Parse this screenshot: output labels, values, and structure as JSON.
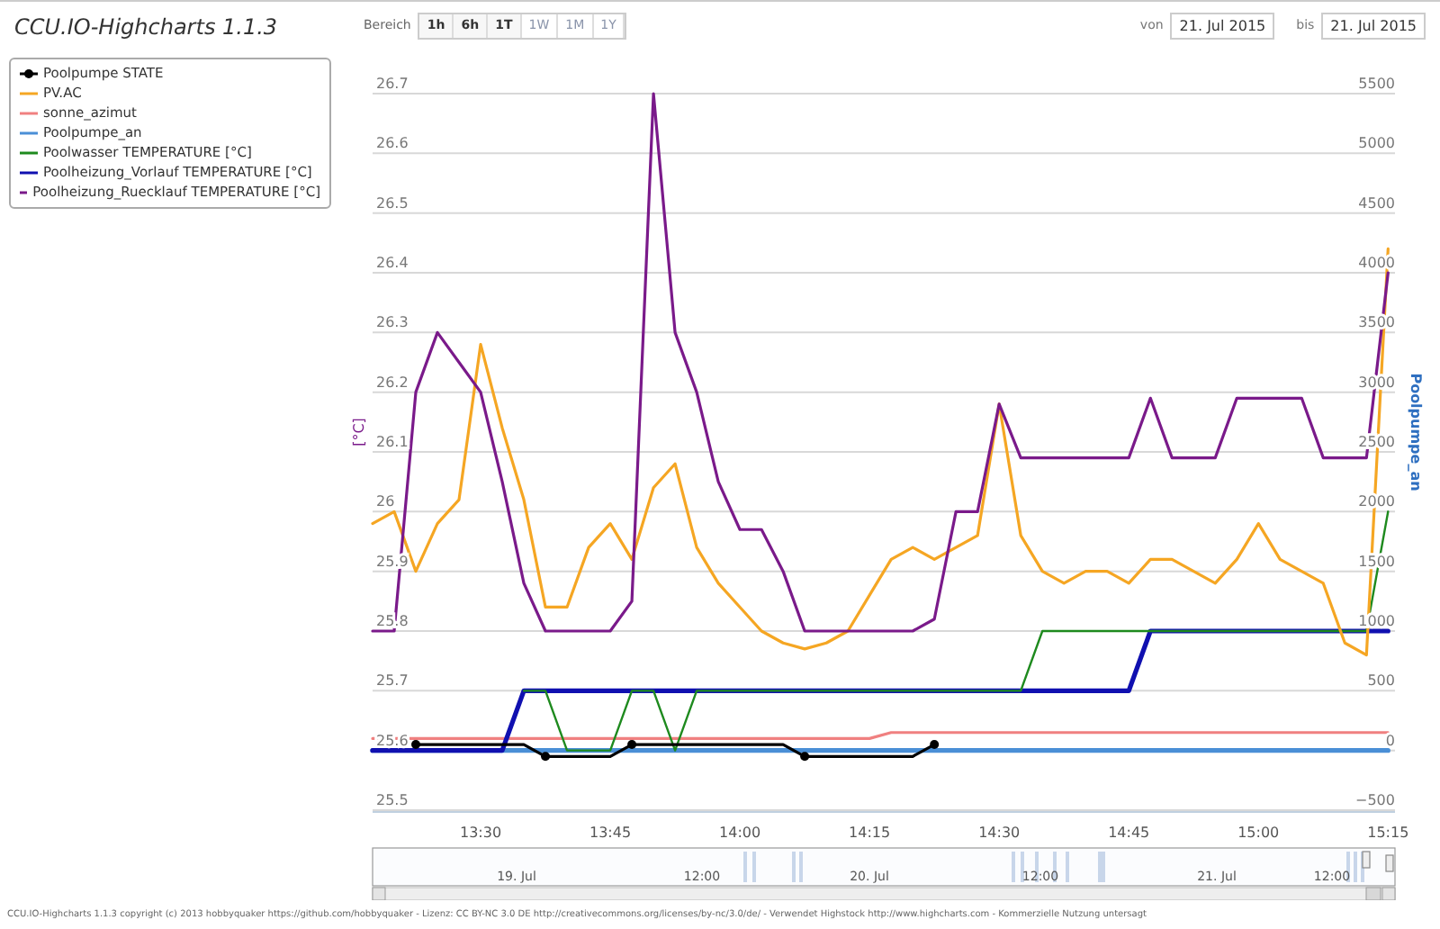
{
  "title": "CCU.IO-Highcharts 1.1.3",
  "range_selector": {
    "label": "Bereich",
    "buttons": [
      {
        "label": "1h",
        "disabled": false
      },
      {
        "label": "6h",
        "disabled": false
      },
      {
        "label": "1T",
        "disabled": false
      },
      {
        "label": "1W",
        "disabled": true
      },
      {
        "label": "1M",
        "disabled": true
      },
      {
        "label": "1Y",
        "disabled": true
      }
    ]
  },
  "date_range": {
    "from_label": "von",
    "from": "21. Jul 2015",
    "to_label": "bis",
    "to": "21. Jul 2015"
  },
  "chart": {
    "chart_data": {
      "type": "line",
      "grid": true,
      "ylabel": "[°C]",
      "ylim": [
        25.5,
        26.7
      ],
      "yticks": [
        25.5,
        25.6,
        25.7,
        25.8,
        25.9,
        {
          "value": 26,
          "label": "26"
        },
        26.1,
        26.2,
        26.3,
        26.4,
        26.5,
        26.6,
        26.7
      ],
      "xlim": [
        797.5,
        915.8
      ],
      "xticks": [
        {
          "value": 810,
          "label": "13:30"
        },
        {
          "value": 825,
          "label": "13:45"
        },
        {
          "value": 840,
          "label": "14:00"
        },
        {
          "value": 855,
          "label": "14:15"
        },
        {
          "value": 870,
          "label": "14:30"
        },
        {
          "value": 885,
          "label": "14:45"
        },
        {
          "value": 900,
          "label": "15:00"
        },
        {
          "value": 915,
          "label": "15:15"
        }
      ],
      "x": [
        797.5,
        800,
        802.5,
        805,
        807.5,
        810,
        812.5,
        815,
        817.5,
        820,
        822.5,
        825,
        827.5,
        830,
        832.5,
        835,
        837.5,
        840,
        842.5,
        845,
        847.5,
        850,
        852.5,
        855,
        857.5,
        860,
        862.5,
        865,
        867.5,
        870,
        872.5,
        875,
        877.5,
        880,
        882.5,
        885,
        887.5,
        890,
        892.5,
        895,
        897.5,
        900,
        902.5,
        905,
        907.5,
        910,
        912.5,
        915
      ],
      "series": [
        {
          "name": "Poolpumpe STATE",
          "color": "#000000",
          "values": [
            null,
            null,
            25.61,
            25.61,
            25.61,
            25.61,
            25.61,
            25.61,
            25.59,
            25.59,
            25.59,
            25.59,
            25.61,
            25.61,
            25.61,
            25.61,
            25.61,
            25.61,
            25.61,
            25.61,
            25.59,
            25.59,
            25.59,
            25.59,
            25.59,
            25.59,
            25.61,
            null,
            null,
            null,
            null,
            null,
            null,
            null,
            null,
            null,
            null,
            null,
            null,
            null,
            null,
            null,
            null,
            null,
            null,
            null,
            null,
            null
          ]
        },
        {
          "name": "PV.AC",
          "color": "#f5a623",
          "values": [
            25.98,
            26.0,
            25.9,
            25.98,
            26.02,
            26.28,
            26.14,
            26.02,
            25.84,
            25.84,
            25.94,
            25.98,
            25.92,
            26.04,
            26.08,
            25.94,
            25.88,
            25.84,
            25.8,
            25.78,
            25.77,
            25.78,
            25.8,
            25.86,
            25.92,
            25.94,
            25.92,
            25.94,
            25.96,
            26.18,
            25.96,
            25.9,
            25.88,
            25.9,
            25.9,
            25.88,
            25.92,
            25.92,
            25.9,
            25.88,
            25.92,
            25.98,
            25.92,
            25.9,
            25.88,
            25.78,
            25.76,
            26.44
          ]
        },
        {
          "name": "sonne_azimut",
          "color": "#f08080",
          "values": [
            25.62,
            25.62,
            25.62,
            25.62,
            25.62,
            25.62,
            25.62,
            25.62,
            25.62,
            25.62,
            25.62,
            25.62,
            25.62,
            25.62,
            25.62,
            25.62,
            25.62,
            25.62,
            25.62,
            25.62,
            25.62,
            25.62,
            25.62,
            25.62,
            25.63,
            25.63,
            25.63,
            25.63,
            25.63,
            25.63,
            25.63,
            25.63,
            25.63,
            25.63,
            25.63,
            25.63,
            25.63,
            25.63,
            25.63,
            25.63,
            25.63,
            25.63,
            25.63,
            25.63,
            25.63,
            25.63,
            25.63,
            25.63
          ]
        },
        {
          "name": "Poolpumpe_an",
          "color": "#4a8fd6",
          "values": [
            25.6,
            25.6,
            25.6,
            25.6,
            25.6,
            25.6,
            25.6,
            25.6,
            25.6,
            25.6,
            25.6,
            25.6,
            25.6,
            25.6,
            25.6,
            25.6,
            25.6,
            25.6,
            25.6,
            25.6,
            25.6,
            25.6,
            25.6,
            25.6,
            25.6,
            25.6,
            25.6,
            25.6,
            25.6,
            25.6,
            25.6,
            25.6,
            25.6,
            25.6,
            25.6,
            25.6,
            25.6,
            25.6,
            25.6,
            25.6,
            25.6,
            25.6,
            25.6,
            25.6,
            25.6,
            25.6,
            25.6,
            25.6
          ]
        },
        {
          "name": "Poolwasser TEMPERATURE [°C]",
          "color": "#1e8a1e",
          "values": [
            null,
            null,
            null,
            null,
            null,
            null,
            null,
            25.7,
            25.7,
            25.6,
            25.6,
            25.6,
            25.7,
            25.7,
            25.6,
            25.7,
            25.7,
            25.7,
            25.7,
            25.7,
            25.7,
            25.7,
            25.7,
            25.7,
            25.7,
            25.7,
            25.7,
            25.7,
            25.7,
            25.7,
            25.7,
            25.8,
            25.8,
            25.8,
            25.8,
            25.8,
            25.8,
            25.8,
            25.8,
            25.8,
            25.8,
            25.8,
            25.8,
            25.8,
            25.8,
            25.8,
            25.8,
            26.0
          ]
        },
        {
          "name": "Poolheizung_Vorlauf TEMPERATURE [°C]",
          "color": "#1010b0",
          "values": [
            25.6,
            25.6,
            25.6,
            25.6,
            25.6,
            25.6,
            25.6,
            25.7,
            25.7,
            25.7,
            25.7,
            25.7,
            25.7,
            25.7,
            25.7,
            25.7,
            25.7,
            25.7,
            25.7,
            25.7,
            25.7,
            25.7,
            25.7,
            25.7,
            25.7,
            25.7,
            25.7,
            25.7,
            25.7,
            25.7,
            25.7,
            25.7,
            25.7,
            25.7,
            25.7,
            25.7,
            25.8,
            25.8,
            25.8,
            25.8,
            25.8,
            25.8,
            25.8,
            25.8,
            25.8,
            25.8,
            25.8,
            25.8
          ]
        },
        {
          "name": "Poolheizung_Ruecklauf TEMPERATURE [°C]",
          "color": "#7a1a8a",
          "values": [
            25.8,
            25.8,
            26.2,
            26.3,
            26.25,
            26.2,
            26.05,
            25.88,
            25.8,
            25.8,
            25.8,
            25.8,
            25.85,
            26.7,
            26.3,
            26.2,
            26.05,
            25.97,
            25.97,
            25.9,
            25.8,
            25.8,
            25.8,
            25.8,
            25.8,
            25.8,
            25.82,
            26.0,
            26.0,
            26.18,
            26.09,
            26.09,
            26.09,
            26.09,
            26.09,
            26.09,
            26.19,
            26.09,
            26.09,
            26.09,
            26.19,
            26.19,
            26.19,
            26.19,
            26.09,
            26.09,
            26.09,
            26.4
          ]
        }
      ]
    },
    "right_axis": {
      "title": "Poolpumpe_an",
      "ticks": [
        "5500",
        "5000",
        "4500",
        "4000",
        "3500",
        "3000",
        "2500",
        "2000",
        "1500",
        "1000",
        "500",
        "0",
        "−500"
      ]
    },
    "navigator": {
      "labels": [
        "19. Jul",
        "12:00",
        "20. Jul",
        "12:00",
        "21. Jul",
        "12:00"
      ]
    }
  },
  "footer": "CCU.IO-Highcharts 1.1.3 copyright (c) 2013 hobbyquaker https://github.com/hobbyquaker - Lizenz: CC BY-NC 3.0 DE http://creativecommons.org/licenses/by-nc/3.0/de/ - Verwendet Highstock http://www.highcharts.com - Kommerzielle Nutzung untersagt"
}
